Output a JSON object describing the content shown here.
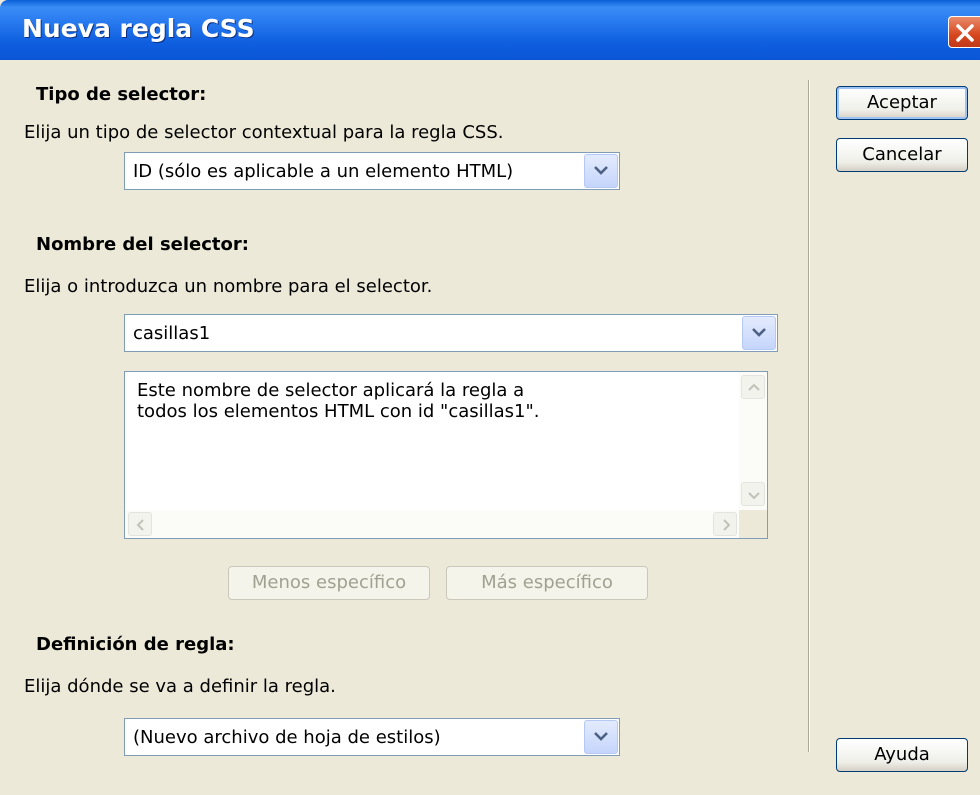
{
  "window": {
    "title": "Nueva regla CSS"
  },
  "selector_type": {
    "heading": "Tipo de selector:",
    "description": "Elija un tipo de selector contextual para la regla CSS.",
    "selected": "ID (sólo es aplicable a un elemento HTML)"
  },
  "selector_name": {
    "heading": "Nombre del selector:",
    "description": "Elija o introduzca un nombre para el selector.",
    "value": "casillas1",
    "info_line1": "Este nombre de selector aplicará la regla a",
    "info_line2": "todos los elementos HTML con id \"casillas1\".",
    "less_specific": "Menos específico",
    "more_specific": "Más específico"
  },
  "rule_definition": {
    "heading": "Definición de regla:",
    "description": "Elija dónde se va a definir la regla.",
    "selected": "(Nuevo archivo de hoja de estilos)"
  },
  "buttons": {
    "ok": "Aceptar",
    "cancel": "Cancelar",
    "help": "Ayuda"
  }
}
